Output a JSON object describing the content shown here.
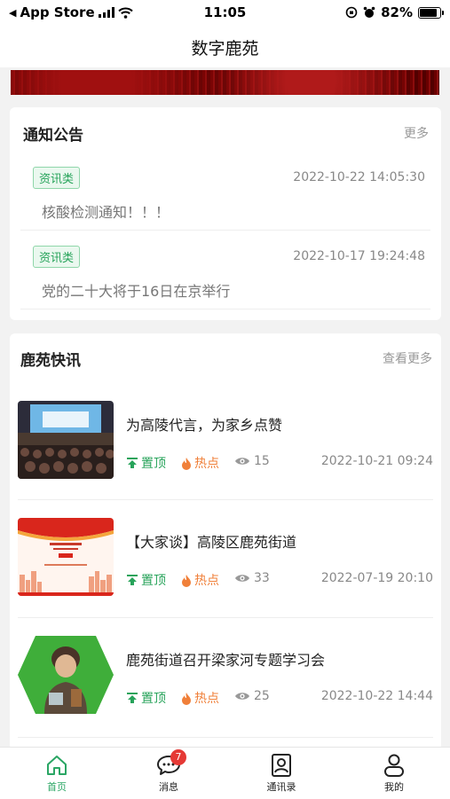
{
  "status": {
    "back_app": "App Store",
    "time": "11:05",
    "battery": "82%"
  },
  "header": {
    "title": "数字鹿苑"
  },
  "notices": {
    "title": "通知公告",
    "more": "更多",
    "items": [
      {
        "tag": "资讯类",
        "time": "2022-10-22 14:05:30",
        "title": "核酸检测通知！！！"
      },
      {
        "tag": "资讯类",
        "time": "2022-10-17 19:24:48",
        "title": "党的二十大将于16日在京举行"
      }
    ]
  },
  "news": {
    "title": "鹿苑快讯",
    "more": "查看更多",
    "items": [
      {
        "title": "为高陵代言，为家乡点赞",
        "top": "置顶",
        "hot": "热点",
        "views": "15",
        "date": "2022-10-21 09:24"
      },
      {
        "title": "【大家谈】高陵区鹿苑街道",
        "top": "置顶",
        "hot": "热点",
        "views": "33",
        "date": "2022-07-19 20:10"
      },
      {
        "title": "鹿苑街道召开梁家河专题学习会",
        "top": "置顶",
        "hot": "热点",
        "views": "25",
        "date": "2022-10-22 14:44"
      }
    ]
  },
  "tabbar": {
    "items": [
      {
        "label": "首页"
      },
      {
        "label": "消息",
        "badge": "7"
      },
      {
        "label": "通讯录"
      },
      {
        "label": "我的"
      }
    ]
  },
  "colors": {
    "accent": "#2aa664",
    "hot": "#f0803a",
    "badge": "#e53935"
  }
}
